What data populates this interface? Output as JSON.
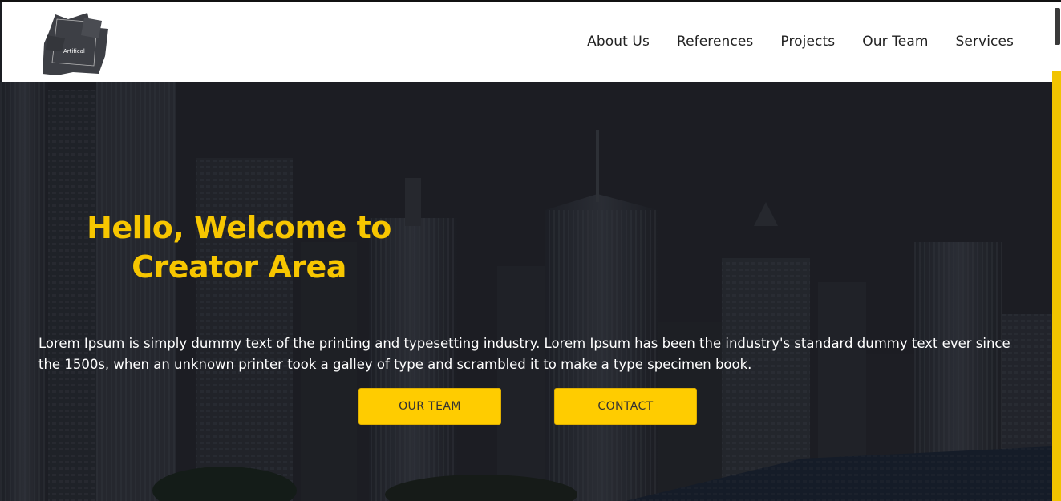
{
  "header": {
    "logo_text": "Artifical",
    "nav": [
      {
        "label": "About Us"
      },
      {
        "label": "References"
      },
      {
        "label": "Projects"
      },
      {
        "label": "Our Team"
      },
      {
        "label": "Services"
      }
    ]
  },
  "hero": {
    "title_line1": "Hello, Welcome to",
    "title_line2": "Creator Area",
    "description": "Lorem Ipsum is simply dummy text of the printing and typesetting industry. Lorem Ipsum has been the industry's standard dummy text ever since the 1500s, when an unknown printer took a galley of type and scrambled it to make a type specimen book.",
    "buttons": {
      "team_label": "OUR TEAM",
      "contact_label": "CONTACT"
    }
  },
  "colors": {
    "accent": "#ffcc00",
    "title": "#f7c600",
    "header_bg": "#ffffff",
    "hero_bg": "#1b1d22"
  }
}
